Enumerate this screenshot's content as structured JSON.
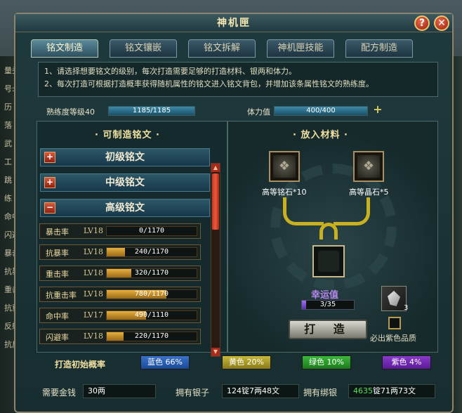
{
  "window": {
    "title": "神机匣",
    "help_label": "?",
    "close_label": "✕"
  },
  "tabs": [
    {
      "label": "铭文制造",
      "active": true
    },
    {
      "label": "铭文镶嵌",
      "active": false
    },
    {
      "label": "铭文拆解",
      "active": false
    },
    {
      "label": "神机匣技能",
      "active": false
    },
    {
      "label": "配方制造",
      "active": false
    }
  ],
  "notes": [
    "1、请选择想要铭文的级别，每次打造需要足够的打造材料、银两和体力。",
    "2、每次打造可根据打造概率获得随机属性的铭文进入铭文背包，并增加该条属性铭文的熟练度。"
  ],
  "stats": {
    "proficiency_label": "熟练度等级40",
    "proficiency_value": "1185/1185",
    "proficiency_fraction": 1.0,
    "stamina_label": "体力值",
    "stamina_value": "400/400",
    "stamina_fraction": 1.0,
    "stamina_add": "+"
  },
  "left_panel": {
    "heading": "· 可制造铭文 ·",
    "categories": [
      {
        "icon": "+",
        "label": "初级铭文"
      },
      {
        "icon": "+",
        "label": "中级铭文"
      },
      {
        "icon": "−",
        "label": "高级铭文"
      }
    ],
    "recipes": [
      {
        "name": "暴击率",
        "level": "LV18",
        "progress": "0/1170",
        "fraction": 0.0
      },
      {
        "name": "抗暴率",
        "level": "LV18",
        "progress": "240/1170",
        "fraction": 0.205
      },
      {
        "name": "重击率",
        "level": "LV18",
        "progress": "320/1170",
        "fraction": 0.274
      },
      {
        "name": "抗重击率",
        "level": "LV18",
        "progress": "780/1170",
        "fraction": 0.667
      },
      {
        "name": "命中率",
        "level": "LV17",
        "progress": "490/1110",
        "fraction": 0.441
      },
      {
        "name": "闪避率",
        "level": "LV18",
        "progress": "220/1170",
        "fraction": 0.188
      }
    ],
    "scroll_up": "▲",
    "scroll_down": "▼"
  },
  "right_panel": {
    "heading": "· 放入材料 ·",
    "materials": [
      {
        "label": "高等铭石*10"
      },
      {
        "label": "高等晶石*5"
      }
    ],
    "luck_label": "幸运值",
    "luck_value": "3/35",
    "luck_fraction": 0.086,
    "luck_item_count": "3",
    "forge_label": "打 造",
    "purple_label": "必出紫色品质"
  },
  "probability": {
    "label": "打造初始概率",
    "tiers": [
      {
        "text": "蓝色 66%",
        "color": "#2a5ab0"
      },
      {
        "text": "黄色 20%",
        "color": "#a89a28"
      },
      {
        "text": "绿色 10%",
        "color": "#2a9a2a"
      },
      {
        "text": "紫色 4%",
        "color": "#7a2ab0"
      }
    ]
  },
  "currency": {
    "gold_label": "需要金钱",
    "gold_value": "30两",
    "silver_label": "拥有银子",
    "silver_value": "124锭7两48文",
    "bound_label": "拥有绑银",
    "bound_value_highlight": "4635",
    "bound_value_rest": "锭71两73文"
  },
  "background": {
    "left_labels": [
      "量头",
      "号:",
      "历",
      "落",
      "武",
      "工",
      "跳",
      "练",
      "命中",
      "闪避",
      "暴击",
      "抗暴",
      "重击",
      "抗重",
      "反射",
      "抗反"
    ]
  }
}
